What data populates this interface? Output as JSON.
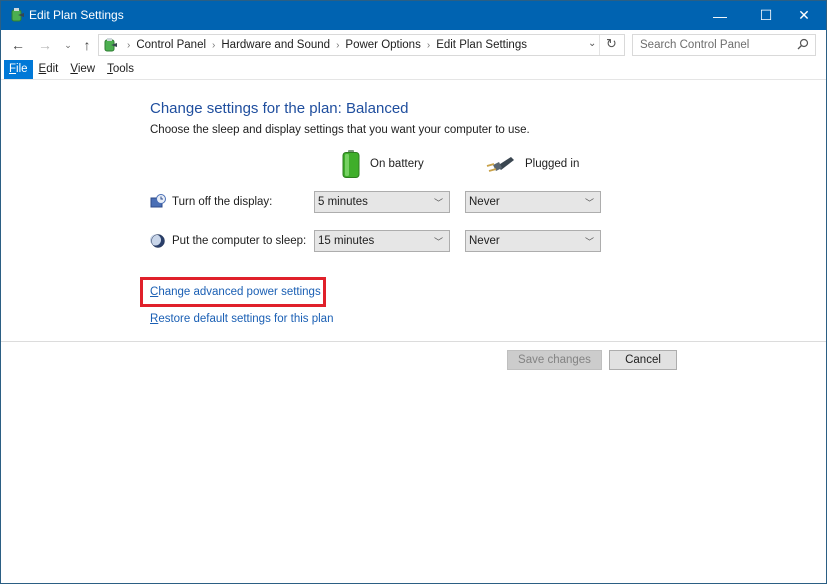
{
  "window": {
    "title": "Edit Plan Settings",
    "controls": {
      "minimize": "—",
      "maximize": "☐",
      "close": "✕"
    }
  },
  "nav": {
    "back": "←",
    "forward": "→",
    "recent": "⌄",
    "up": "↑"
  },
  "address": {
    "breadcrumbs": [
      "Control Panel",
      "Hardware and Sound",
      "Power Options",
      "Edit Plan Settings"
    ],
    "separator": "›",
    "dropdown": "⌄",
    "refresh": "↻"
  },
  "search": {
    "placeholder": "Search Control Panel",
    "value": ""
  },
  "menu": {
    "items": [
      {
        "label": "File",
        "accel": "F",
        "rest": "ile",
        "active": true
      },
      {
        "label": "Edit",
        "accel": "E",
        "rest": "dit"
      },
      {
        "label": "View",
        "accel": "V",
        "rest": "iew"
      },
      {
        "label": "Tools",
        "accel": "T",
        "rest": "ools"
      }
    ]
  },
  "main": {
    "title": "Change settings for the plan: Balanced",
    "subtitle": "Choose the sleep and display settings that you want your computer to use.",
    "columns": {
      "battery": "On battery",
      "plugged": "Plugged in"
    },
    "rows": [
      {
        "label": "Turn off the display:",
        "battery": "5 minutes",
        "plugged": "Never"
      },
      {
        "label": "Put the computer to sleep:",
        "battery": "15 minutes",
        "plugged": "Never"
      }
    ],
    "links": {
      "advanced": {
        "accel": "C",
        "rest": "hange advanced power settings"
      },
      "restore": {
        "accel": "R",
        "rest": "estore default settings for this plan"
      }
    },
    "buttons": {
      "save": "Save changes",
      "cancel": "Cancel"
    }
  },
  "colors": {
    "titlebar": "#0063b1",
    "menu_active": "#0078d7",
    "link": "#1a5fb4",
    "title": "#1f4e9e",
    "highlight": "#e0202a"
  }
}
